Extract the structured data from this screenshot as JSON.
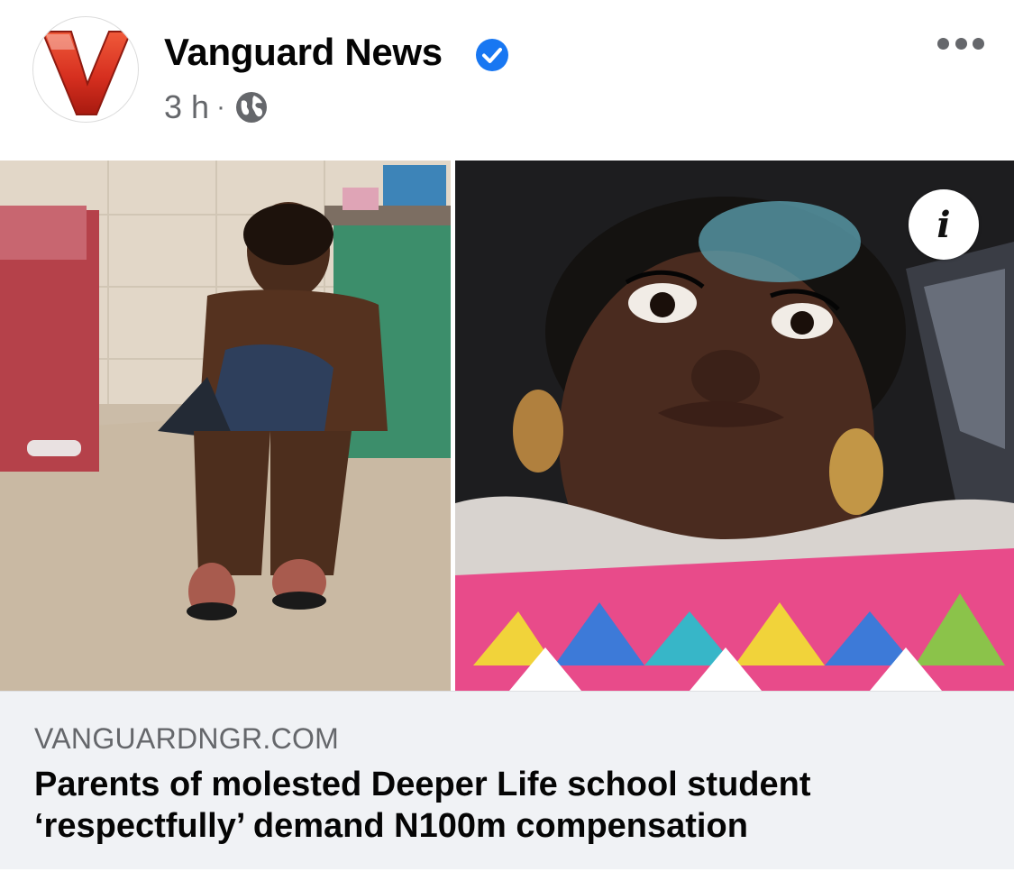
{
  "post": {
    "page_name": "Vanguard News",
    "time": "3 h",
    "separator": "·",
    "logo_letter": "V"
  },
  "link": {
    "domain": "VANGUARDNGR.COM",
    "headline": "Parents of molested Deeper Life school student ‘respectfully’ demand N100m compensation"
  },
  "media": {
    "info_symbol": "i"
  },
  "colors": {
    "verified_badge": "#1877f2",
    "logo_red": "#d62f1f",
    "link_bg": "#f0f2f5",
    "secondary_text": "#65676b"
  },
  "icons": [
    "vanguard-logo",
    "verified-badge-icon",
    "globe-icon",
    "more-options-icon",
    "info-icon"
  ]
}
